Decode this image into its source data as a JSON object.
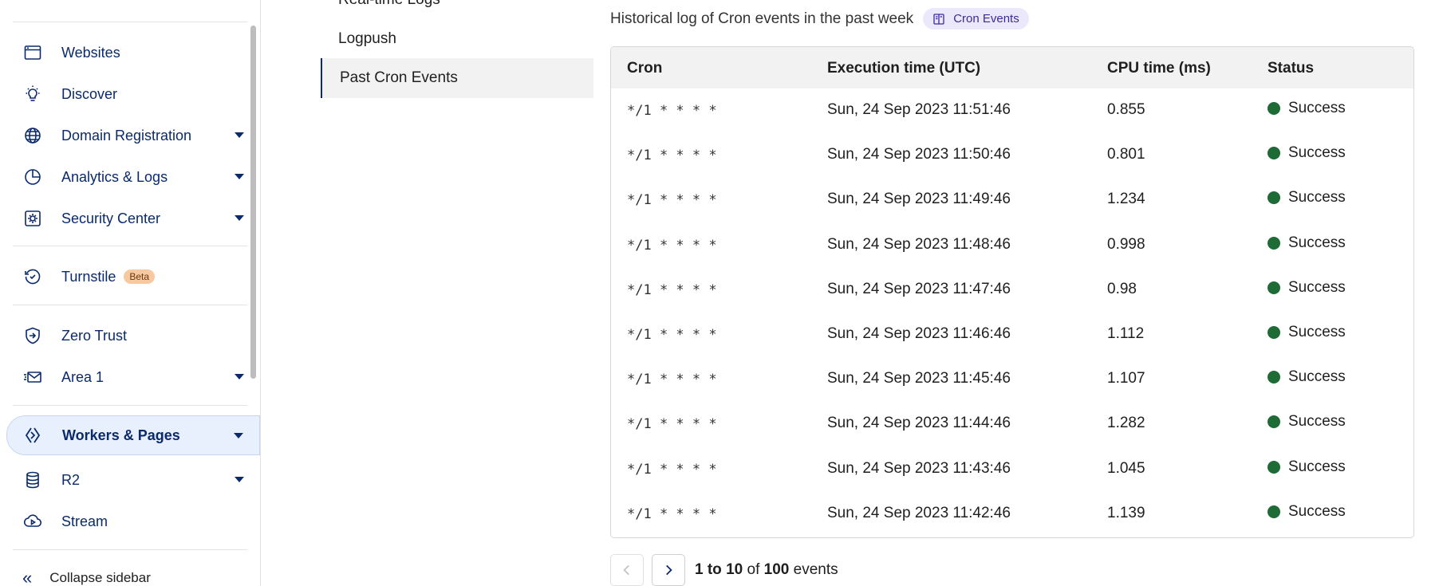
{
  "sidebar": {
    "items": [
      {
        "label": "Websites",
        "icon": "browser-window-icon",
        "caret": false
      },
      {
        "label": "Discover",
        "icon": "lightbulb-icon",
        "caret": false
      },
      {
        "label": "Domain Registration",
        "icon": "globe-icon",
        "caret": true
      },
      {
        "label": "Analytics & Logs",
        "icon": "pie-chart-icon",
        "caret": true
      },
      {
        "label": "Security Center",
        "icon": "security-gear-icon",
        "caret": true
      },
      {
        "label": "Turnstile",
        "icon": "turnstile-icon",
        "caret": false,
        "badge": "Beta"
      },
      {
        "label": "Zero Trust",
        "icon": "shield-arrow-icon",
        "caret": false
      },
      {
        "label": "Area 1",
        "icon": "mail-icon",
        "caret": true
      },
      {
        "label": "Workers & Pages",
        "icon": "workers-icon",
        "caret": true,
        "active": true
      },
      {
        "label": "R2",
        "icon": "database-icon",
        "caret": true
      },
      {
        "label": "Stream",
        "icon": "cloud-play-icon",
        "caret": false
      }
    ],
    "collapse_label": "Collapse sidebar"
  },
  "subnav": {
    "items": [
      {
        "label": "Real-time Logs"
      },
      {
        "label": "Logpush"
      },
      {
        "label": "Past Cron Events",
        "selected": true
      }
    ]
  },
  "main": {
    "heading": "Historical log of Cron events in the past week",
    "docs_badge": "Cron Events",
    "table": {
      "columns": [
        "Cron",
        "Execution time (UTC)",
        "CPU time (ms)",
        "Status"
      ],
      "rows": [
        {
          "cron": "*/1 * * * *",
          "time": "Sun, 24 Sep 2023 11:51:46",
          "cpu": "0.855",
          "status": "Success"
        },
        {
          "cron": "*/1 * * * *",
          "time": "Sun, 24 Sep 2023 11:50:46",
          "cpu": "0.801",
          "status": "Success"
        },
        {
          "cron": "*/1 * * * *",
          "time": "Sun, 24 Sep 2023 11:49:46",
          "cpu": "1.234",
          "status": "Success"
        },
        {
          "cron": "*/1 * * * *",
          "time": "Sun, 24 Sep 2023 11:48:46",
          "cpu": "0.998",
          "status": "Success"
        },
        {
          "cron": "*/1 * * * *",
          "time": "Sun, 24 Sep 2023 11:47:46",
          "cpu": "0.98",
          "status": "Success"
        },
        {
          "cron": "*/1 * * * *",
          "time": "Sun, 24 Sep 2023 11:46:46",
          "cpu": "1.112",
          "status": "Success"
        },
        {
          "cron": "*/1 * * * *",
          "time": "Sun, 24 Sep 2023 11:45:46",
          "cpu": "1.107",
          "status": "Success"
        },
        {
          "cron": "*/1 * * * *",
          "time": "Sun, 24 Sep 2023 11:44:46",
          "cpu": "1.282",
          "status": "Success"
        },
        {
          "cron": "*/1 * * * *",
          "time": "Sun, 24 Sep 2023 11:43:46",
          "cpu": "1.045",
          "status": "Success"
        },
        {
          "cron": "*/1 * * * *",
          "time": "Sun, 24 Sep 2023 11:42:46",
          "cpu": "1.139",
          "status": "Success"
        }
      ]
    },
    "pagination": {
      "range_start": "1",
      "to_word": "to",
      "range_end": "10",
      "of_word": "of",
      "total": "100",
      "unit": "events"
    }
  },
  "colors": {
    "nav_text": "#0b2a6b",
    "success": "#1e6b36",
    "active_bg": "#e8f0fd",
    "badge_bg": "#ece8fb",
    "beta_bg": "#f7c9a1"
  }
}
